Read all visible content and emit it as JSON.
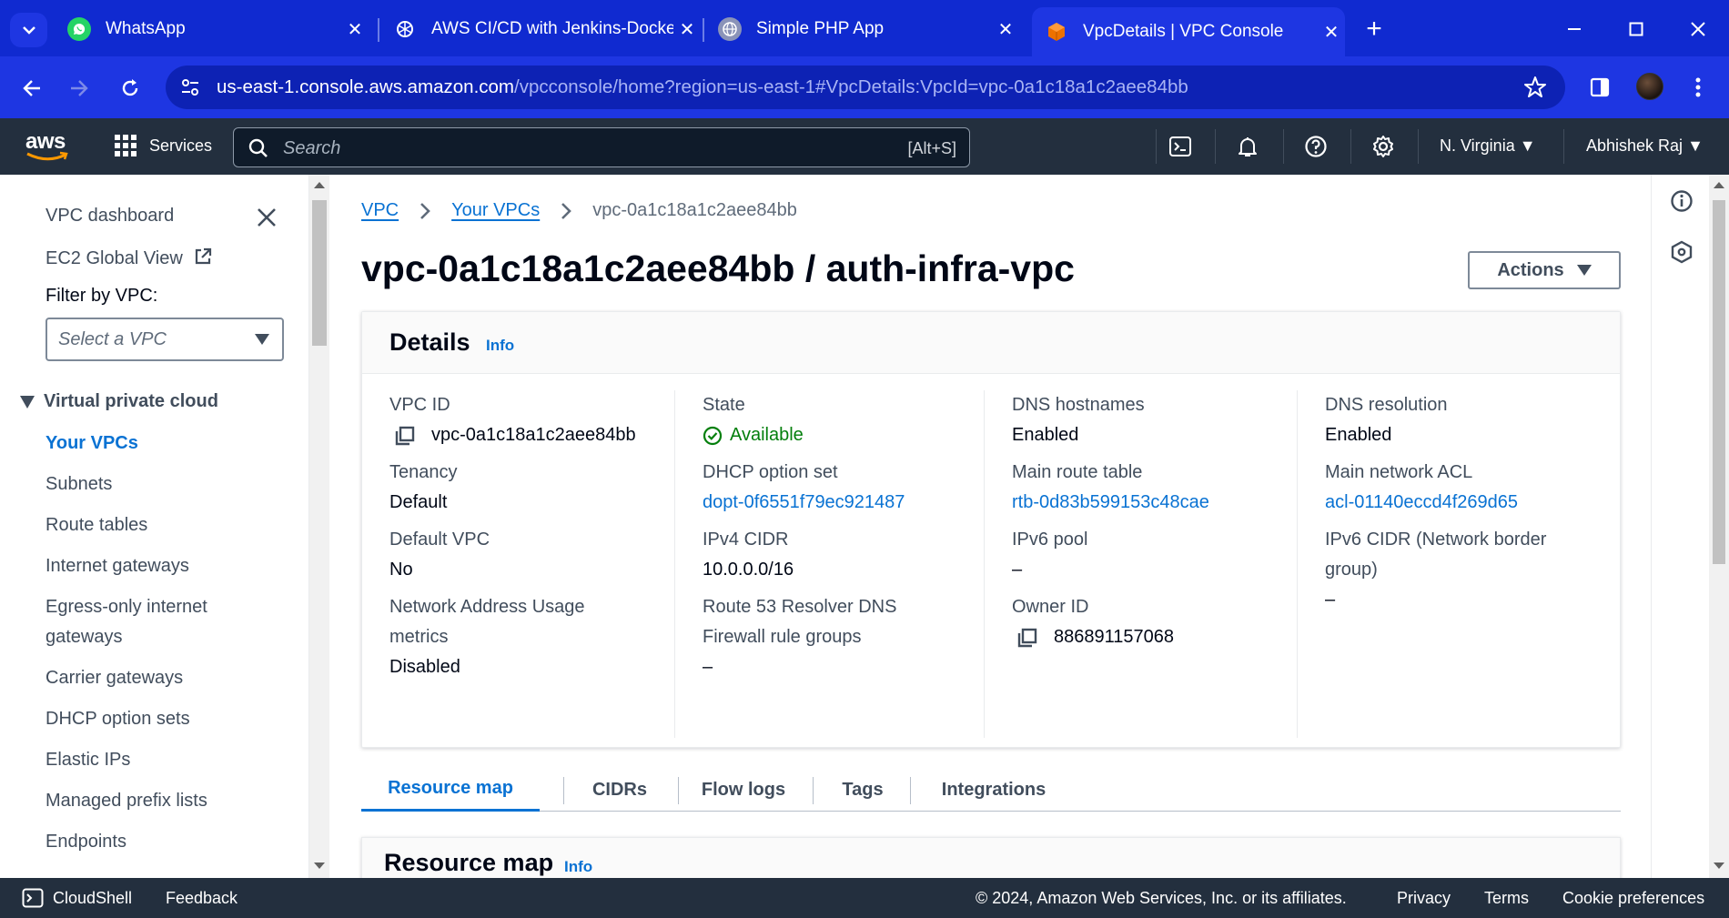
{
  "browser": {
    "tabs": [
      {
        "title": "WhatsApp",
        "icon": "whatsapp-icon"
      },
      {
        "title": "AWS CI/CD with Jenkins-Docker",
        "icon": "chatgpt-icon"
      },
      {
        "title": "Simple PHP App",
        "icon": "globe-icon"
      },
      {
        "title": "VpcDetails | VPC Console",
        "icon": "aws-cube-icon",
        "active": true
      }
    ],
    "url_host": "us-east-1.console.aws.amazon.com",
    "url_path": "/vpcconsole/home?region=us-east-1#VpcDetails:VpcId=vpc-0a1c18a1c2aee84bb"
  },
  "aws_header": {
    "logo_text": "aws",
    "services_label": "Services",
    "search_placeholder": "Search",
    "search_shortcut": "[Alt+S]",
    "region": "N. Virginia",
    "user": "Abhishek Raj"
  },
  "sidenav": {
    "dashboard": "VPC dashboard",
    "global_view": "EC2 Global View",
    "filter_label": "Filter by VPC:",
    "filter_placeholder": "Select a VPC",
    "section": "Virtual private cloud",
    "items": [
      {
        "label": "Your VPCs",
        "active": true
      },
      {
        "label": "Subnets"
      },
      {
        "label": "Route tables"
      },
      {
        "label": "Internet gateways"
      },
      {
        "label": "Egress-only internet"
      },
      {
        "label": "gateways"
      },
      {
        "label": "Carrier gateways"
      },
      {
        "label": "DHCP option sets"
      },
      {
        "label": "Elastic IPs"
      },
      {
        "label": "Managed prefix lists"
      },
      {
        "label": "Endpoints"
      }
    ]
  },
  "breadcrumb": {
    "root": "VPC",
    "parent": "Your VPCs",
    "current": "vpc-0a1c18a1c2aee84bb"
  },
  "page": {
    "title": "vpc-0a1c18a1c2aee84bb / auth-infra-vpc",
    "actions_label": "Actions"
  },
  "details": {
    "title": "Details",
    "info": "Info",
    "vpc_id_label": "VPC ID",
    "vpc_id": "vpc-0a1c18a1c2aee84bb",
    "state_label": "State",
    "state": "Available",
    "dns_hostnames_label": "DNS hostnames",
    "dns_hostnames": "Enabled",
    "dns_resolution_label": "DNS resolution",
    "dns_resolution": "Enabled",
    "tenancy_label": "Tenancy",
    "tenancy": "Default",
    "dhcp_label": "DHCP option set",
    "dhcp": "dopt-0f6551f79ec921487",
    "route_table_label": "Main route table",
    "route_table": "rtb-0d83b599153c48cae",
    "acl_label": "Main network ACL",
    "acl": "acl-01140eccd4f269d65",
    "default_vpc_label": "Default VPC",
    "default_vpc": "No",
    "ipv4_label": "IPv4 CIDR",
    "ipv4": "10.0.0.0/16",
    "ipv6_pool_label": "IPv6 pool",
    "ipv6_pool": "–",
    "ipv6_cidr_label_1": "IPv6 CIDR (Network border",
    "ipv6_cidr_label_2": "group)",
    "ipv6_cidr": "–",
    "nau_label_1": "Network Address Usage",
    "nau_label_2": "metrics",
    "nau": "Disabled",
    "r53_label_1": "Route 53 Resolver DNS",
    "r53_label_2": "Firewall rule groups",
    "r53": "–",
    "owner_label": "Owner ID",
    "owner": "886891157068"
  },
  "tabs": [
    "Resource map",
    "CIDRs",
    "Flow logs",
    "Tags",
    "Integrations"
  ],
  "resource_map": {
    "title": "Resource map",
    "info": "Info"
  },
  "footer": {
    "cloudshell": "CloudShell",
    "feedback": "Feedback",
    "copyright": "© 2024, Amazon Web Services, Inc. or its affiliates.",
    "privacy": "Privacy",
    "terms": "Terms",
    "cookies": "Cookie preferences"
  },
  "colors": {
    "browser_chrome": "#102ad0",
    "aws_nav": "#232f3e",
    "link": "#0972d3",
    "success": "#037f0c"
  }
}
